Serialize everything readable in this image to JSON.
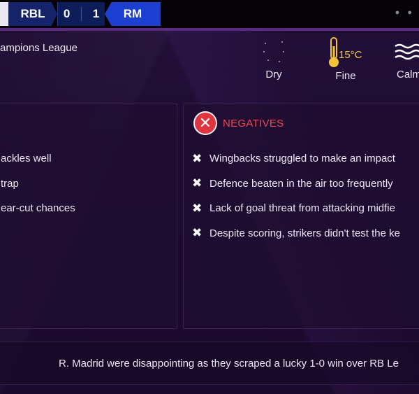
{
  "scoreboard": {
    "home_team": "RBL",
    "home_score": "0",
    "away_score": "1",
    "away_team": "RM"
  },
  "competition": "ampions League",
  "weather": {
    "precipitation": "Dry",
    "sky": "Fine",
    "temperature": "15°C",
    "wind": "Calm"
  },
  "positives": [
    "ackles well",
    " trap",
    "ear-cut chances"
  ],
  "negatives": {
    "title": "NEGATIVES",
    "items": [
      "Wingbacks struggled to make an impact",
      "Defence beaten in the air too frequently",
      "Lack of goal threat from attacking midfie",
      "Despite scoring, strikers didn't test the ke"
    ]
  },
  "summary": "R. Madrid were disappointing as they scraped a lucky 1-0 win over RB Le",
  "colors": {
    "negative_accent": "#e0343f",
    "away_team": "#1b3fd0",
    "home_team": "#15246a",
    "temperature": "#f3c43a"
  },
  "icons": [
    "moon-icon",
    "thermometer-icon",
    "wind-icon",
    "cross-icon",
    "menu-dots-icon"
  ]
}
